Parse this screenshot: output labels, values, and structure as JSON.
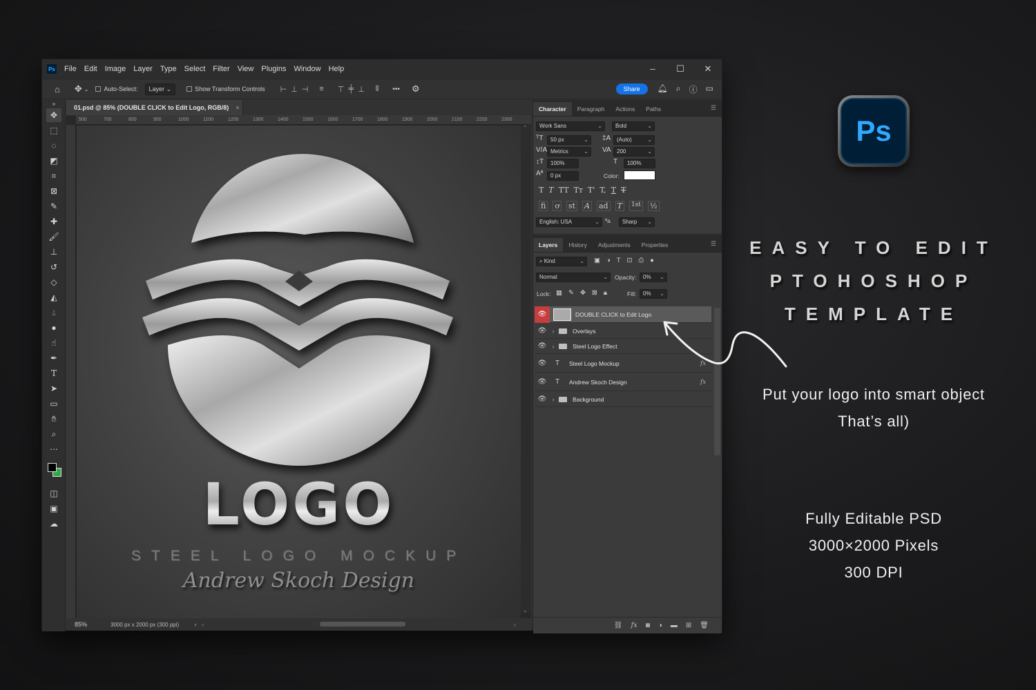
{
  "window": {
    "app_badge": "Ps",
    "menu": [
      "File",
      "Edit",
      "Image",
      "Layer",
      "Type",
      "Select",
      "Filter",
      "View",
      "Plugins",
      "Window",
      "Help"
    ],
    "controls": {
      "minimize": "–",
      "maximize": "☐",
      "close": "✕"
    }
  },
  "options_bar": {
    "auto_select_label": "Auto-Select:",
    "auto_select_target": "Layer",
    "transform_label": "Show Transform Controls",
    "more": "•••",
    "share_label": "Share"
  },
  "document": {
    "tab_title": "01.psd @ 85% (DOUBLE CLICK to Edit Logo, RGB/8)",
    "tab_close": "×",
    "ruler_ticks": [
      "500",
      "700",
      "800",
      "900",
      "1000",
      "1100",
      "1200",
      "1300",
      "1400",
      "1500",
      "1600",
      "1700",
      "1800",
      "1900",
      "2000",
      "2100",
      "2200",
      "2300"
    ],
    "canvas": {
      "logo_word": "LOGO",
      "tagline": "STEEL LOGO MOCKUP",
      "signature": "Andrew Skoch Design"
    },
    "status": {
      "zoom": "85%",
      "dimensions": "3000 px x 2000 px (300 ppi)"
    }
  },
  "character_panel": {
    "tabs": [
      "Character",
      "Paragraph",
      "Actions",
      "Paths"
    ],
    "font_family": "Work Sans",
    "font_style": "Bold",
    "font_size": "50 px",
    "leading": "(Auto)",
    "kerning": "Metrics",
    "tracking": "200",
    "vertical_scale": "100%",
    "horizontal_scale": "100%",
    "baseline_shift": "0 px",
    "color_label": "Color:",
    "color_value": "#ffffff",
    "language": "English: USA",
    "aa_label": "ªa",
    "antialias": "Sharp",
    "type_styles": [
      "T",
      "T",
      "TT",
      "Tт",
      "T'",
      "T,",
      "T",
      "T"
    ],
    "opentype": [
      "ﬁ",
      "ơ",
      "st",
      "A",
      "ad",
      "T",
      "1st",
      "½"
    ]
  },
  "layers_panel": {
    "tabs": [
      "Layers",
      "History",
      "Adjustments",
      "Properties"
    ],
    "filter_label": "Kind",
    "blend_mode": "Normal",
    "opacity_label": "Opacity:",
    "opacity_value": "0%",
    "lock_label": "Lock:",
    "fill_label": "Fill:",
    "fill_value": "0%",
    "layers": [
      {
        "name": "DOUBLE CLICK to Edit Logo",
        "kind": "smart",
        "selected": true
      },
      {
        "name": "Overlays",
        "kind": "group"
      },
      {
        "name": "Steel Logo Effect",
        "kind": "group"
      },
      {
        "name": "Steel Logo Mockup",
        "kind": "text",
        "fx": "fx"
      },
      {
        "name": "Andrew Skoch Design",
        "kind": "text",
        "fx": "fx"
      },
      {
        "name": "Background",
        "kind": "group"
      }
    ]
  },
  "promo": {
    "badge": "Ps",
    "headline": [
      "EASY TO EDIT",
      "PTOHOSHOP",
      "TEMPLATE"
    ],
    "note": [
      "Put your logo into smart object",
      "That’s all)"
    ],
    "specs": [
      "Fully Editable PSD",
      "3000×2000 Pixels",
      "300 DPI"
    ]
  },
  "colors": {
    "accent_blue": "#1473e6",
    "ps_blue": "#31a8ff",
    "ps_navy": "#001e36",
    "selected_eye": "#c53e3e",
    "background_swatch": "#36a84a"
  }
}
